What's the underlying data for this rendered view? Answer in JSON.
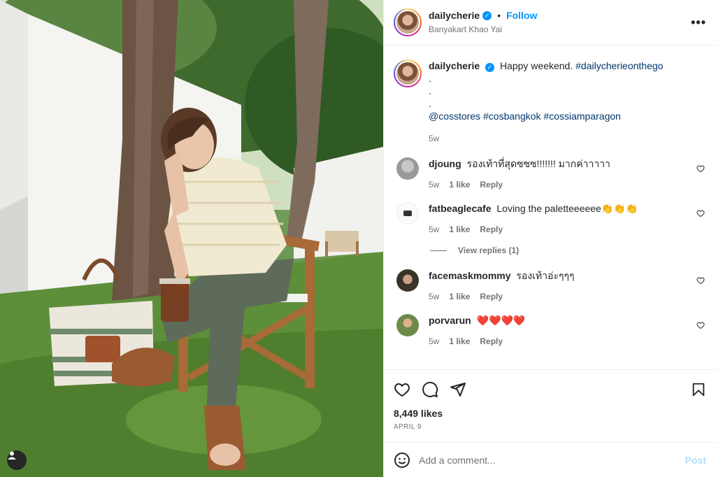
{
  "post": {
    "username": "dailycherie",
    "verified_glyph": "✓",
    "separator": "•",
    "follow_label": "Follow",
    "location": "Banyakart Khao Yai",
    "more_label": "•••",
    "user_tag_icon": "person-icon"
  },
  "caption": {
    "username": "dailycherie",
    "text": "Happy weekend.",
    "hashtag": "#dailycherieonthego",
    "dots": [
      ".",
      ".",
      "."
    ],
    "mention": "@cosstores",
    "tag2": "#cosbangkok",
    "tag3": "#cossiamparagon",
    "time": "5w"
  },
  "comments": [
    {
      "username": "djoung",
      "text": "รองเท้าที่สุดซซซ!!!!!!! มากค่าาาาา",
      "time": "5w",
      "likes": "1 like",
      "reply": "Reply",
      "avatar_color": "#d9d9d9"
    },
    {
      "username": "fatbeaglecafe",
      "text": "Loving the paletteeeeee👏👏👏",
      "time": "5w",
      "likes": "1 like",
      "reply": "Reply",
      "avatar_color": "#f5f5f5",
      "view_replies": "View replies (1)"
    },
    {
      "username": "facemaskmommy",
      "text": "รองเท้าอ่ะๆๆๆ",
      "time": "5w",
      "likes": "1 like",
      "reply": "Reply",
      "avatar_color": "#4a4a3a"
    },
    {
      "username": "porvarun",
      "text": "❤️❤️❤️❤️",
      "time": "5w",
      "likes": "1 like",
      "reply": "Reply",
      "avatar_color": "#7a9a5a"
    }
  ],
  "actions": {
    "likes": "8,449 likes",
    "date": "APRIL 9"
  },
  "add_comment": {
    "placeholder": "Add a comment...",
    "post_label": "Post"
  },
  "colors": {
    "accent": "#0095f6",
    "link": "#00376b",
    "muted": "#737373",
    "post_disabled": "#b2dffc"
  }
}
